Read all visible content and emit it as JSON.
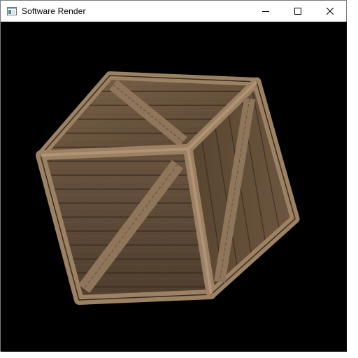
{
  "window": {
    "title": "Software Render",
    "app_icon": "window-app-icon",
    "controls": {
      "minimize": "minimize-icon",
      "maximize": "maximize-icon",
      "close": "close-icon"
    }
  },
  "scene": {
    "object": "wooden-crate",
    "background_color": "#000000",
    "wood_colors": {
      "light": "#8a7156",
      "mid": "#6b5540",
      "dark": "#3f3124",
      "edge": "#a58a69"
    }
  }
}
